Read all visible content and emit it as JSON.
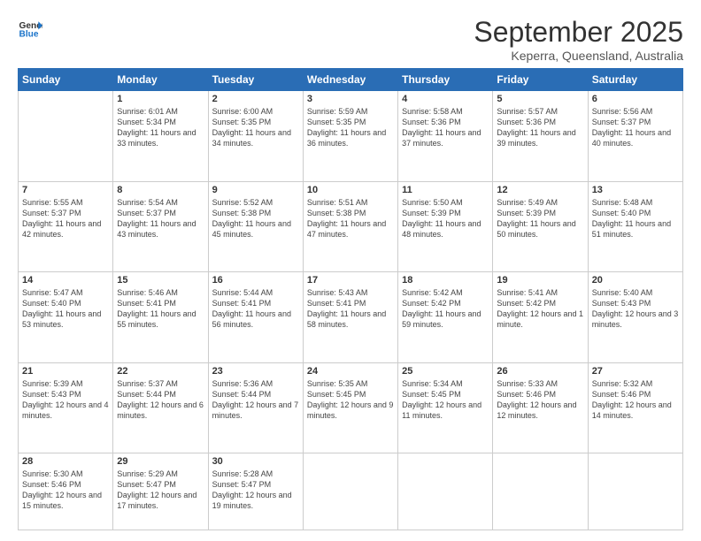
{
  "header": {
    "logo_line1": "General",
    "logo_line2": "Blue",
    "month": "September 2025",
    "location": "Keperra, Queensland, Australia"
  },
  "weekdays": [
    "Sunday",
    "Monday",
    "Tuesday",
    "Wednesday",
    "Thursday",
    "Friday",
    "Saturday"
  ],
  "weeks": [
    [
      {
        "day": "",
        "sunrise": "",
        "sunset": "",
        "daylight": ""
      },
      {
        "day": "1",
        "sunrise": "6:01 AM",
        "sunset": "5:34 PM",
        "daylight": "11 hours and 33 minutes."
      },
      {
        "day": "2",
        "sunrise": "6:00 AM",
        "sunset": "5:35 PM",
        "daylight": "11 hours and 34 minutes."
      },
      {
        "day": "3",
        "sunrise": "5:59 AM",
        "sunset": "5:35 PM",
        "daylight": "11 hours and 36 minutes."
      },
      {
        "day": "4",
        "sunrise": "5:58 AM",
        "sunset": "5:36 PM",
        "daylight": "11 hours and 37 minutes."
      },
      {
        "day": "5",
        "sunrise": "5:57 AM",
        "sunset": "5:36 PM",
        "daylight": "11 hours and 39 minutes."
      },
      {
        "day": "6",
        "sunrise": "5:56 AM",
        "sunset": "5:37 PM",
        "daylight": "11 hours and 40 minutes."
      }
    ],
    [
      {
        "day": "7",
        "sunrise": "5:55 AM",
        "sunset": "5:37 PM",
        "daylight": "11 hours and 42 minutes."
      },
      {
        "day": "8",
        "sunrise": "5:54 AM",
        "sunset": "5:37 PM",
        "daylight": "11 hours and 43 minutes."
      },
      {
        "day": "9",
        "sunrise": "5:52 AM",
        "sunset": "5:38 PM",
        "daylight": "11 hours and 45 minutes."
      },
      {
        "day": "10",
        "sunrise": "5:51 AM",
        "sunset": "5:38 PM",
        "daylight": "11 hours and 47 minutes."
      },
      {
        "day": "11",
        "sunrise": "5:50 AM",
        "sunset": "5:39 PM",
        "daylight": "11 hours and 48 minutes."
      },
      {
        "day": "12",
        "sunrise": "5:49 AM",
        "sunset": "5:39 PM",
        "daylight": "11 hours and 50 minutes."
      },
      {
        "day": "13",
        "sunrise": "5:48 AM",
        "sunset": "5:40 PM",
        "daylight": "11 hours and 51 minutes."
      }
    ],
    [
      {
        "day": "14",
        "sunrise": "5:47 AM",
        "sunset": "5:40 PM",
        "daylight": "11 hours and 53 minutes."
      },
      {
        "day": "15",
        "sunrise": "5:46 AM",
        "sunset": "5:41 PM",
        "daylight": "11 hours and 55 minutes."
      },
      {
        "day": "16",
        "sunrise": "5:44 AM",
        "sunset": "5:41 PM",
        "daylight": "11 hours and 56 minutes."
      },
      {
        "day": "17",
        "sunrise": "5:43 AM",
        "sunset": "5:41 PM",
        "daylight": "11 hours and 58 minutes."
      },
      {
        "day": "18",
        "sunrise": "5:42 AM",
        "sunset": "5:42 PM",
        "daylight": "11 hours and 59 minutes."
      },
      {
        "day": "19",
        "sunrise": "5:41 AM",
        "sunset": "5:42 PM",
        "daylight": "12 hours and 1 minute."
      },
      {
        "day": "20",
        "sunrise": "5:40 AM",
        "sunset": "5:43 PM",
        "daylight": "12 hours and 3 minutes."
      }
    ],
    [
      {
        "day": "21",
        "sunrise": "5:39 AM",
        "sunset": "5:43 PM",
        "daylight": "12 hours and 4 minutes."
      },
      {
        "day": "22",
        "sunrise": "5:37 AM",
        "sunset": "5:44 PM",
        "daylight": "12 hours and 6 minutes."
      },
      {
        "day": "23",
        "sunrise": "5:36 AM",
        "sunset": "5:44 PM",
        "daylight": "12 hours and 7 minutes."
      },
      {
        "day": "24",
        "sunrise": "5:35 AM",
        "sunset": "5:45 PM",
        "daylight": "12 hours and 9 minutes."
      },
      {
        "day": "25",
        "sunrise": "5:34 AM",
        "sunset": "5:45 PM",
        "daylight": "12 hours and 11 minutes."
      },
      {
        "day": "26",
        "sunrise": "5:33 AM",
        "sunset": "5:46 PM",
        "daylight": "12 hours and 12 minutes."
      },
      {
        "day": "27",
        "sunrise": "5:32 AM",
        "sunset": "5:46 PM",
        "daylight": "12 hours and 14 minutes."
      }
    ],
    [
      {
        "day": "28",
        "sunrise": "5:30 AM",
        "sunset": "5:46 PM",
        "daylight": "12 hours and 15 minutes."
      },
      {
        "day": "29",
        "sunrise": "5:29 AM",
        "sunset": "5:47 PM",
        "daylight": "12 hours and 17 minutes."
      },
      {
        "day": "30",
        "sunrise": "5:28 AM",
        "sunset": "5:47 PM",
        "daylight": "12 hours and 19 minutes."
      },
      {
        "day": "",
        "sunrise": "",
        "sunset": "",
        "daylight": ""
      },
      {
        "day": "",
        "sunrise": "",
        "sunset": "",
        "daylight": ""
      },
      {
        "day": "",
        "sunrise": "",
        "sunset": "",
        "daylight": ""
      },
      {
        "day": "",
        "sunrise": "",
        "sunset": "",
        "daylight": ""
      }
    ]
  ]
}
